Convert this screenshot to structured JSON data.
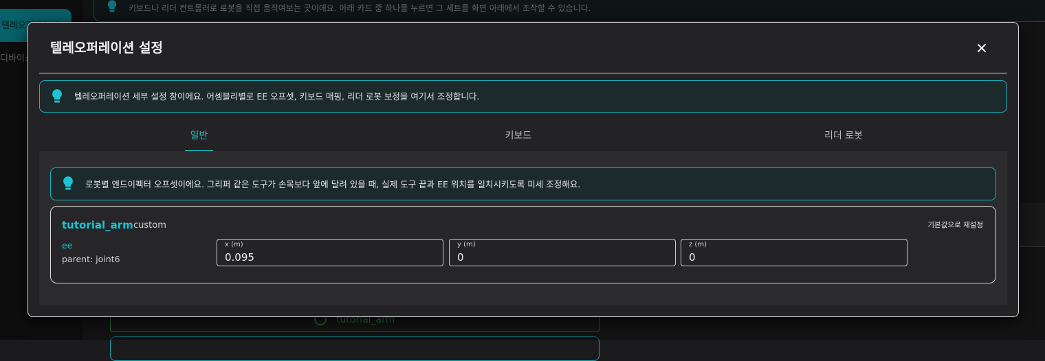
{
  "background": {
    "sidebar_active_label": "텔레오퍼레이션",
    "sidebar_item_label": "디바이스",
    "banner_text": "키보드나 리더 컨트롤러로 로봇을 직접 움직여보는 곳이에요. 아래 카드 중 하나를 누르면 그 세트를 화면 아래에서 조작할 수 있습니다.",
    "robot_button_label": "tutorial_arm"
  },
  "modal": {
    "title": "텔레오퍼레이션 설정",
    "close_label": "close",
    "info_banner": "텔레오퍼레이션 세부 설정 창이에요. 어셈블리별로 EE 오프셋, 키보드 매핑, 리더 로봇 보정을 여기서 조정합니다.",
    "tabs": [
      {
        "label": "일반",
        "active": true
      },
      {
        "label": "키보드",
        "active": false
      },
      {
        "label": "리더 로봇",
        "active": false
      }
    ],
    "general": {
      "info_banner": "로봇별 엔드이펙터 오프셋이에요. 그리퍼 같은 도구가 손목보다 앞에 달려 있을 때, 실제 도구 끝과 EE 위치를 일치시키도록 미세 조정해요.",
      "robot": {
        "name": "tutorial_arm",
        "tag": "custom",
        "reset_label": "기본값으로 재설정",
        "link_name": "ee",
        "parent_label": "parent: joint6",
        "fields": [
          {
            "label": "x (m)",
            "value": "0.095"
          },
          {
            "label": "y (m)",
            "value": "0"
          },
          {
            "label": "z (m)",
            "value": "0"
          }
        ]
      }
    }
  },
  "colors": {
    "accent": "#1cc3d2",
    "banner_border": "#14b8c6",
    "modal_bg": "#232325",
    "content_bg": "#2c2c2f",
    "success": "#2aa84a"
  },
  "icons": {
    "bulb": "lightbulb-icon",
    "close": "close-icon",
    "robot_button": "power-icon"
  }
}
